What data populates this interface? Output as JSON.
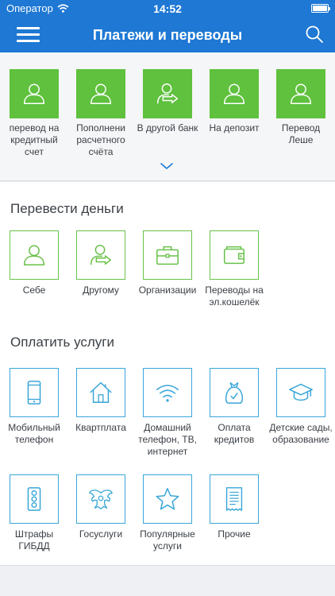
{
  "status_bar": {
    "carrier": "Оператор",
    "time": "14:52"
  },
  "header": {
    "title": "Платежи и переводы"
  },
  "quick_actions": [
    {
      "label": "перевод на кредитный счет",
      "icon": "person-icon"
    },
    {
      "label": "Пополнени расчетного счёта",
      "icon": "person-icon"
    },
    {
      "label": "В другой банк",
      "icon": "transfer-icon"
    },
    {
      "label": "На депозит",
      "icon": "person-icon"
    },
    {
      "label": "Перевод Леше",
      "icon": "person-icon"
    }
  ],
  "transfer_section": {
    "title": "Перевести деньги",
    "items": [
      {
        "label": "Себе",
        "icon": "person-icon"
      },
      {
        "label": "Другому",
        "icon": "transfer-icon"
      },
      {
        "label": "Организации",
        "icon": "briefcase-icon"
      },
      {
        "label": "Переводы на эл.кошелёк",
        "icon": "wallet-icon"
      }
    ]
  },
  "services_section": {
    "title": "Оплатить услуги",
    "items": [
      {
        "label": "Мобильный телефон",
        "icon": "phone-icon"
      },
      {
        "label": "Квартплата",
        "icon": "house-icon"
      },
      {
        "label": "Домашний телефон, ТВ, интернет",
        "icon": "wifi-icon"
      },
      {
        "label": "Оплата кредитов",
        "icon": "money-bag-icon"
      },
      {
        "label": "Детские сады, образование",
        "icon": "graduation-cap-icon"
      },
      {
        "label": "Штрафы ГИБДД",
        "icon": "traffic-light-icon"
      },
      {
        "label": "Госуслуги",
        "icon": "emblem-icon"
      },
      {
        "label": "Популярные услуги",
        "icon": "star-icon"
      },
      {
        "label": "Прочие",
        "icon": "receipt-icon"
      }
    ]
  },
  "colors": {
    "brand": "#1e78d4",
    "quick_tile": "#5fc13d",
    "transfer_border": "#69c14a",
    "service_border": "#3aa6d8"
  }
}
